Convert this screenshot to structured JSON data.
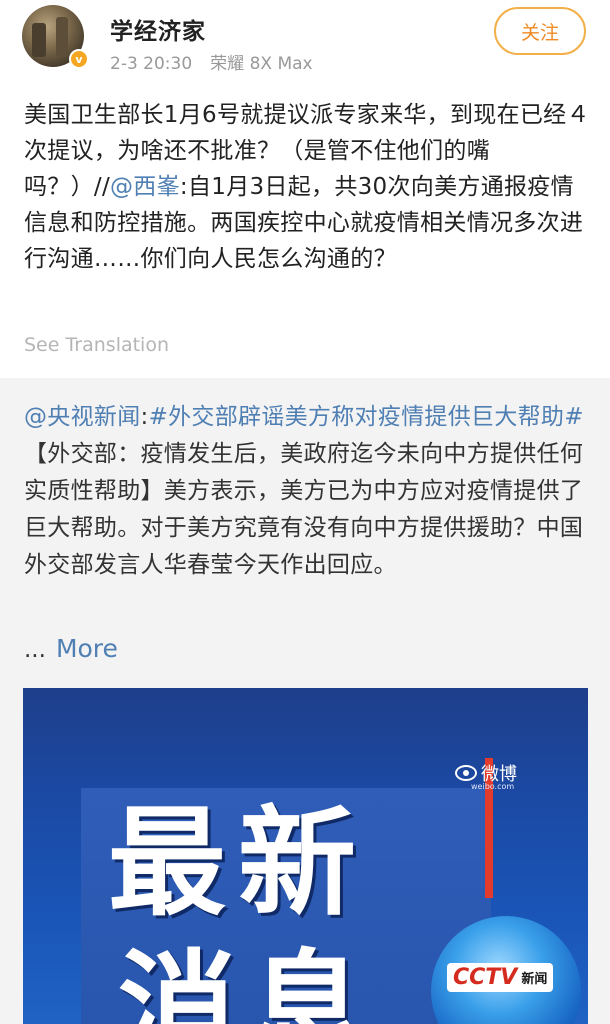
{
  "post": {
    "author": "学经济家",
    "time": "2-3 20:30",
    "device": "荣耀 8X Max",
    "follow_label": "关注",
    "verified_badge": "v",
    "text_part1": "美国卫生部长1月6号就提议派专家来华，到现在已经４次提议，为啥还不批准？（是管不住他们的嘴吗？）//",
    "mention": "@西峯",
    "text_part2": ":自1月3日起，共30次向美方通报疫情信息和防控措施。两国疾控中心就疫情相关情况多次进行沟通……你们向人民怎么沟通的？",
    "see_translation": "See Translation"
  },
  "repost": {
    "source": "@央视新闻",
    "colon": ":",
    "hashtag": "#外交部辟谣美方称对疫情提供巨大帮助#",
    "body": "【外交部：疫情发生后，美政府迄今未向中方提供任何实质性帮助】美方表示，美方已为中方应对疫情提供了巨大帮助。对于美方究竟有没有向中方提供援助？中国外交部发言人华春莹今天作出回应。",
    "ellipsis": "...",
    "more_label": "More"
  },
  "image": {
    "headline_line1": "最新",
    "headline_line2": "消息",
    "weibo_label": "微博",
    "weibo_sub": "weibo.com",
    "cctv_label": "CCTV",
    "cctv_news": "新闻"
  },
  "colors": {
    "link": "#4f7fb3",
    "follow": "#f08a24",
    "badge": "#f5a623",
    "repost_bg": "#f3f3f3"
  }
}
